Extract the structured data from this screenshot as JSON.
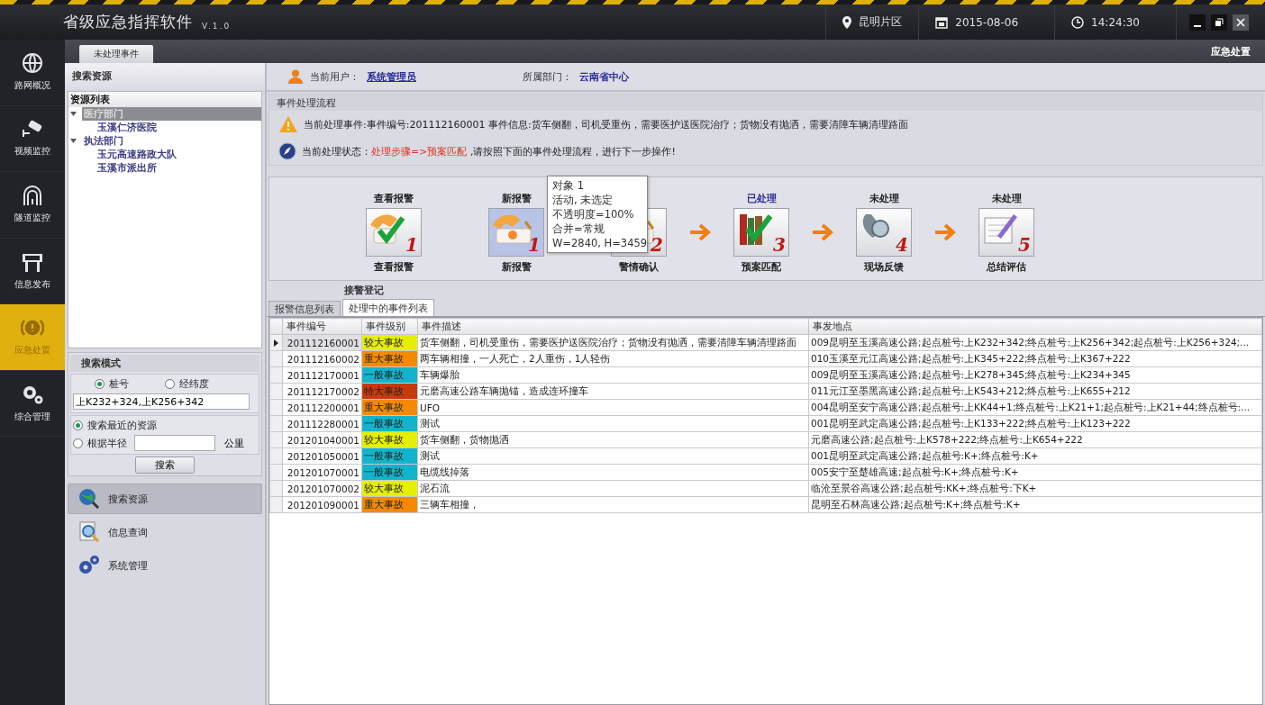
{
  "window": {
    "title": "省级应急指挥软件",
    "version": "V.1.0",
    "region": "昆明片区",
    "date": "2015-08-06",
    "time": "14:24:30"
  },
  "nav": [
    {
      "label": "路网概况",
      "kind": "globe",
      "selected": false
    },
    {
      "label": "视频监控",
      "kind": "camera",
      "selected": false
    },
    {
      "label": "隧道监控",
      "kind": "tunnel",
      "selected": false
    },
    {
      "label": "信息发布",
      "kind": "sign",
      "selected": false
    },
    {
      "label": "应急处置",
      "kind": "alert",
      "selected": true
    },
    {
      "label": "综合管理",
      "kind": "gears",
      "selected": false
    }
  ],
  "top_tabs": [
    {
      "label": "未处理事件",
      "selected": true
    }
  ],
  "module_title": "应急处置",
  "left_panel": {
    "title": "搜索资源",
    "tree_title": "资源列表",
    "tree": [
      {
        "label": "医疗部门",
        "expanded": true,
        "selected": true,
        "children": [
          {
            "label": "玉溪仁济医院",
            "selected": false
          }
        ]
      },
      {
        "label": "执法部门",
        "expanded": true,
        "selected": false,
        "children": [
          {
            "label": "玉元高速路政大队",
            "selected": false
          },
          {
            "label": "玉溪市派出所",
            "selected": false
          }
        ]
      }
    ],
    "search_mode": {
      "title": "搜索模式",
      "mode_options": [
        {
          "label": "桩号",
          "selected": true
        },
        {
          "label": "经纬度",
          "selected": false
        }
      ],
      "position_value": "上K232+324,上K256+342",
      "range_options": [
        {
          "label": "搜索最近的资源",
          "selected": true
        },
        {
          "label": "根据半径",
          "selected": false
        }
      ],
      "unit": "公里",
      "button": "搜索"
    },
    "actions": [
      {
        "label": "搜索资源",
        "kind": "globe",
        "selected": true
      },
      {
        "label": "信息查询",
        "kind": "document",
        "selected": false
      },
      {
        "label": "系统管理",
        "kind": "gears",
        "selected": false
      }
    ]
  },
  "user_bar": {
    "user_label": "当前用户：",
    "user": "系统管理员",
    "dept_label": "所属部门：",
    "dept": "云南省中心"
  },
  "process": {
    "title": "事件处理流程",
    "event_prefix": "当前处理事件:事件编号:201112160001  事件信息:货车侧翻，司机受重伤，需要医护送医院治疗；货物没有抛洒，需要清障车辆清理路面",
    "status_label": "当前处理状态：",
    "status_value": "处理步骤=>预案匹配",
    "status_suffix": " ,请按照下面的事件处理流程，进行下一步操作!"
  },
  "steps": [
    {
      "top": "查看报警",
      "bottom": "查看报警",
      "number": "1",
      "kind": "phone-check",
      "highlighted": false,
      "selected": false
    },
    {
      "top": "新报警",
      "bottom": "新报警",
      "number": "1",
      "kind": "phone",
      "arrow_before": false,
      "highlighted": false,
      "selected": true
    },
    {
      "bottom": "警情确认",
      "number": "2",
      "kind": "phone",
      "selected": false
    },
    {
      "top": "已处理",
      "bottom": "预案匹配",
      "number": "3",
      "kind": "books",
      "arrow_before": true,
      "highlighted": true,
      "selected": false
    },
    {
      "top": "未处理",
      "bottom": "现场反馈",
      "number": "4",
      "kind": "handset",
      "arrow_before": true,
      "highlighted": false,
      "selected": false
    },
    {
      "top": "未处理",
      "bottom": "总结评估",
      "number": "5",
      "kind": "notepad",
      "arrow_before": true,
      "highlighted": false,
      "selected": false
    }
  ],
  "tooltip": {
    "lines": [
      "对象 1",
      "活动, 未选定",
      "不透明度=100%",
      "合并=常规",
      "W=2840, H=3459"
    ]
  },
  "flow_caption": "接警登记",
  "list_tabs": [
    {
      "label": "报警信息列表",
      "selected": false
    },
    {
      "label": "处理中的事件列表",
      "selected": true
    }
  ],
  "table": {
    "columns": [
      "事件编号",
      "事件级别",
      "事件描述",
      "事发地点"
    ],
    "rows": [
      {
        "id": "201112160001",
        "level": "较大事故",
        "color": "#e5f000",
        "desc": "货车侧翻，司机受重伤，需要医护送医院治疗；货物没有抛洒，需要清障车辆清理路面",
        "place": "009昆明至玉溪高速公路;起点桩号:上K232+342;终点桩号:上K256+342;起点桩号:上K256+324;...",
        "selected": true
      },
      {
        "id": "201112160002",
        "level": "重大事故",
        "color": "#f58a00",
        "desc": "两车辆相撞，一人死亡，2人重伤，1人轻伤",
        "place": "010玉溪至元江高速公路;起点桩号:上K345+222;终点桩号:上K367+222",
        "selected": false
      },
      {
        "id": "201112170001",
        "level": "一般事故",
        "color": "#12b4cc",
        "desc": "车辆爆胎",
        "place": "009昆明至玉溪高速公路;起点桩号:上K278+345;终点桩号:上K234+345",
        "selected": false
      },
      {
        "id": "201112170002",
        "level": "特大事故",
        "color": "#c73a0a",
        "desc": "元磨高速公路车辆抛锚，造成连环撞车",
        "place": "011元江至墨黑高速公路;起点桩号:上K543+212;终点桩号:上K655+212",
        "selected": false
      },
      {
        "id": "201112200001",
        "level": "重大事故",
        "color": "#f58a00",
        "desc": "UFO",
        "place": "004昆明至安宁高速公路;起点桩号:上KK44+1;终点桩号:上K21+1;起点桩号:上K21+44;终点桩号:...",
        "selected": false
      },
      {
        "id": "201112280001",
        "level": "一般事故",
        "color": "#12b4cc",
        "desc": "测试",
        "place": "001昆明至武定高速公路;起点桩号:上K133+222;终点桩号:上K123+222",
        "selected": false
      },
      {
        "id": "201201040001",
        "level": "较大事故",
        "color": "#e5f000",
        "desc": "货车侧翻，货物抛洒",
        "place": "元磨高速公路;起点桩号:上K578+222;终点桩号:上K654+222",
        "selected": false
      },
      {
        "id": "201201050001",
        "level": "一般事故",
        "color": "#12b4cc",
        "desc": "测试",
        "place": "001昆明至武定高速公路;起点桩号:K+;终点桩号:K+",
        "selected": false
      },
      {
        "id": "201201070001",
        "level": "一般事故",
        "color": "#12b4cc",
        "desc": "电缆线掉落",
        "place": "005安宁至楚雄高速;起点桩号:K+;终点桩号:K+",
        "selected": false
      },
      {
        "id": "201201070002",
        "level": "较大事故",
        "color": "#e5f000",
        "desc": "泥石流",
        "place": "临沧至景谷高速公路;起点桩号:KK+;终点桩号:下K+",
        "selected": false
      },
      {
        "id": "201201090001",
        "level": "重大事故",
        "color": "#f58a00",
        "desc": "三辆车相撞，",
        "place": "昆明至石林高速公路;起点桩号:K+;终点桩号:K+",
        "selected": false
      }
    ]
  }
}
